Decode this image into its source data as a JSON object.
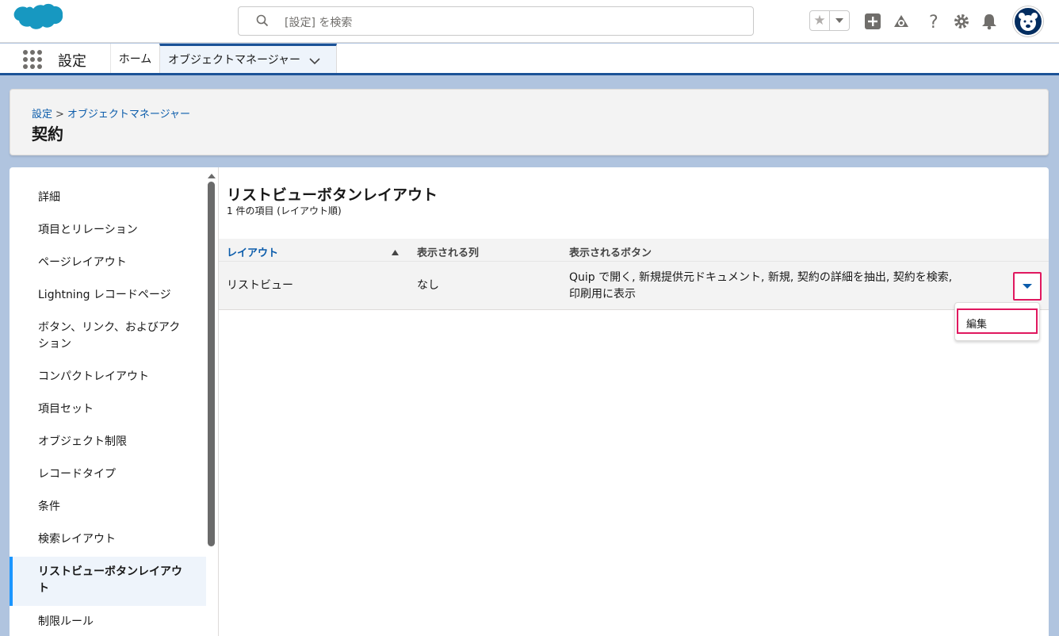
{
  "header": {
    "search_placeholder": "[設定] を検索"
  },
  "nav": {
    "app_name": "設定",
    "tabs": [
      {
        "label": "ホーム"
      },
      {
        "label": "オブジェクトマネージャー"
      }
    ]
  },
  "page": {
    "breadcrumb": [
      "設定",
      "オブジェクトマネージャー"
    ],
    "breadcrumb_sep": ">",
    "title": "契約"
  },
  "sidebar": {
    "items": [
      {
        "label": "詳細"
      },
      {
        "label": "項目とリレーション"
      },
      {
        "label": "ページレイアウト"
      },
      {
        "label": "Lightning レコードページ"
      },
      {
        "label": "ボタン、リンク、およびアクション"
      },
      {
        "label": "コンパクトレイアウト"
      },
      {
        "label": "項目セット"
      },
      {
        "label": "オブジェクト制限"
      },
      {
        "label": "レコードタイプ"
      },
      {
        "label": "条件"
      },
      {
        "label": "検索レイアウト"
      },
      {
        "label": "リストビューボタンレイアウト"
      },
      {
        "label": "制限ルール"
      }
    ],
    "active_index": 11
  },
  "content": {
    "title": "リストビューボタンレイアウト",
    "subtitle": "1 件の項目 (レイアウト順)",
    "columns": [
      "レイアウト",
      "表示される列",
      "表示されるボタン"
    ],
    "rows": [
      {
        "layout": "リストビュー",
        "columns": "なし",
        "buttons_line1": "Quip で開く, 新規提供元ドキュメント, 新規, 契約の詳細を抽出, 契約を検索,",
        "buttons_line2": "印刷用に表示"
      }
    ],
    "row_menu": {
      "items": [
        "編集"
      ]
    }
  },
  "colors": {
    "brand": "#1b5297",
    "link": "#0b5cab",
    "highlight": "#e0185f"
  }
}
